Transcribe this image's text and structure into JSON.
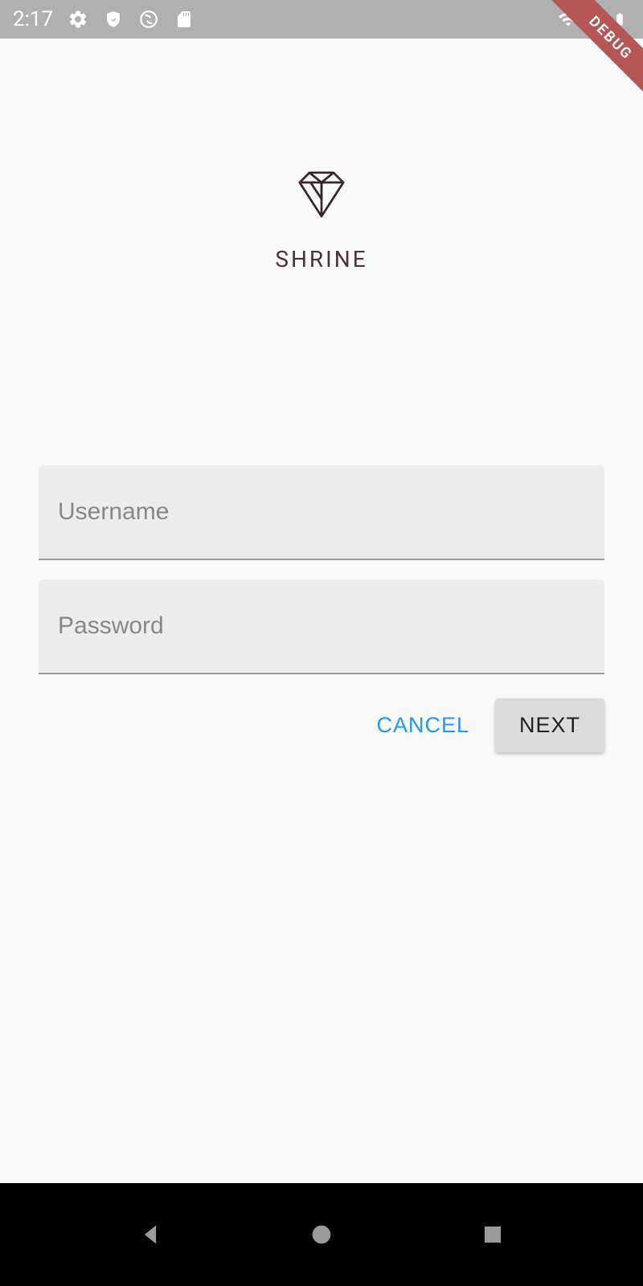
{
  "status_bar": {
    "time": "2:17"
  },
  "debug_banner": "DEBUG",
  "app": {
    "title": "SHRINE"
  },
  "form": {
    "username_placeholder": "Username",
    "password_placeholder": "Password"
  },
  "buttons": {
    "cancel": "CANCEL",
    "next": "NEXT"
  }
}
